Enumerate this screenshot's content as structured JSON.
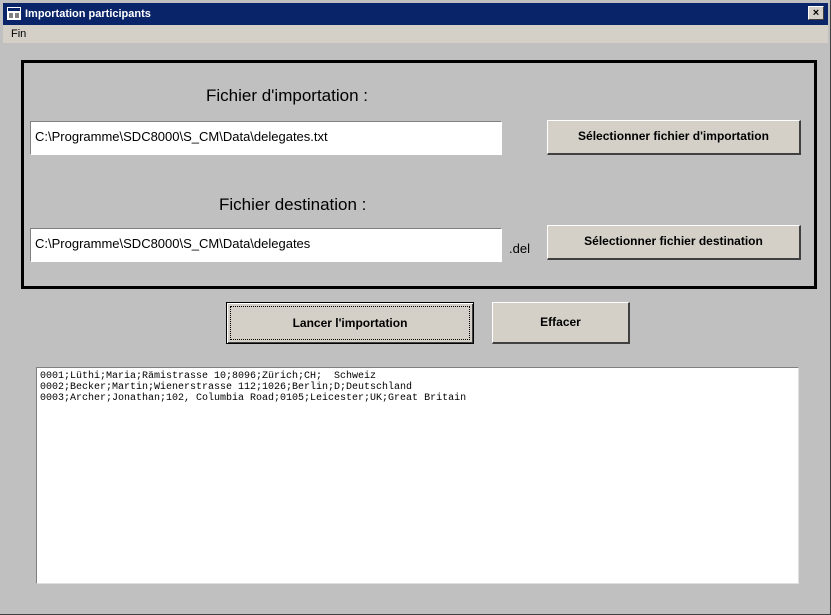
{
  "window": {
    "title": "Importation participants",
    "close_symbol": "×"
  },
  "menu": {
    "items": [
      "Fin"
    ]
  },
  "import_section": {
    "label": "Fichier d'importation :",
    "path_value": "C:\\Programme\\SDC8000\\S_CM\\Data\\delegates.txt",
    "select_button": "Sélectionner fichier d'importation"
  },
  "destination_section": {
    "label": "Fichier destination :",
    "path_value": "C:\\Programme\\SDC8000\\S_CM\\Data\\delegates",
    "extension": ".del",
    "select_button": "Sélectionner fichier destination"
  },
  "actions": {
    "start_button": "Lancer l'importation",
    "clear_button": "Effacer"
  },
  "output": {
    "lines": [
      "0001;Lüthi;Maria;Rämistrasse 10;8096;Zürich;CH;  Schweiz",
      "0002;Becker;Martin;Wienerstrasse 112;1026;Berlin;D;Deutschland",
      "0003;Archer;Jonathan;102, Columbia Road;0105;Leicester;UK;Great Britain"
    ]
  },
  "colors": {
    "titlebar": "#0a246a",
    "window_bg": "#c0c0c0",
    "button_face": "#d4d0c8"
  }
}
